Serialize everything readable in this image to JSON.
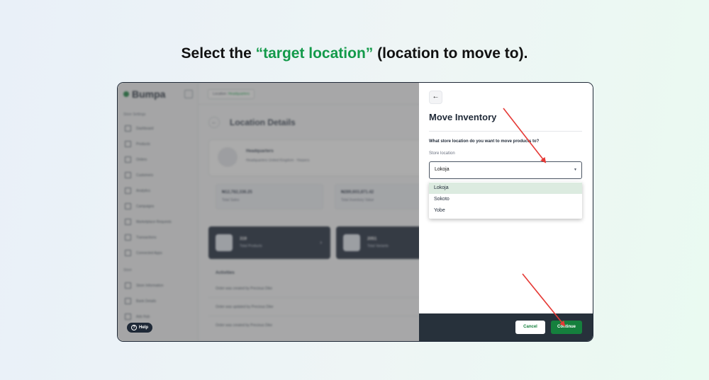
{
  "instruction": {
    "prefix": "Select the ",
    "highlight": "“target location”",
    "suffix": " (location to move to)."
  },
  "app": {
    "brand": "Bumpa",
    "store_selector": {
      "label": "Location:",
      "value": "Headquarters"
    },
    "sidebar": {
      "section_store": "Store Settings",
      "items": [
        "Dashboard",
        "Products",
        "Orders",
        "Customers",
        "Analytics",
        "Campaigns",
        "Marketplace Requests",
        "Transactions",
        "Connected Apps"
      ],
      "section_more": "Store",
      "more_items": [
        "Store Information",
        "Bank Details",
        "Ads Hub"
      ]
    },
    "page_title": "Location Details",
    "location_card": {
      "name": "Headquarters",
      "address": "Headquarters United Kingdom · Harpers"
    },
    "stats": [
      {
        "value": "₦12,782,336.25",
        "label": "Total Sales"
      },
      {
        "value": "₦289,603,871.42",
        "label": "Total Inventory Value"
      }
    ],
    "tiles": [
      {
        "value": "319",
        "label": "Total Products"
      },
      {
        "value": "2051",
        "label": "Total Variants"
      }
    ],
    "activities_title": "Activities",
    "activities": [
      "Order was created by Precious Dike",
      "Order was updated by Precious Dike",
      "Order was updated by Precious Dike",
      "Order was created by Precious Dike"
    ],
    "help_label": "Help"
  },
  "drawer": {
    "title": "Move Inventory",
    "question": "What store location do you want to move products to?",
    "field_label": "Store location",
    "selected_value": "Lokoja",
    "options": [
      "Lokoja",
      "Sokoto",
      "Yobe"
    ],
    "cancel_label": "Cancel",
    "continue_label": "Continue"
  },
  "colors": {
    "accent_green": "#139a4a",
    "primary_button": "#15803d",
    "annotation_arrow": "#e53935",
    "footer_dark": "#27313b"
  }
}
